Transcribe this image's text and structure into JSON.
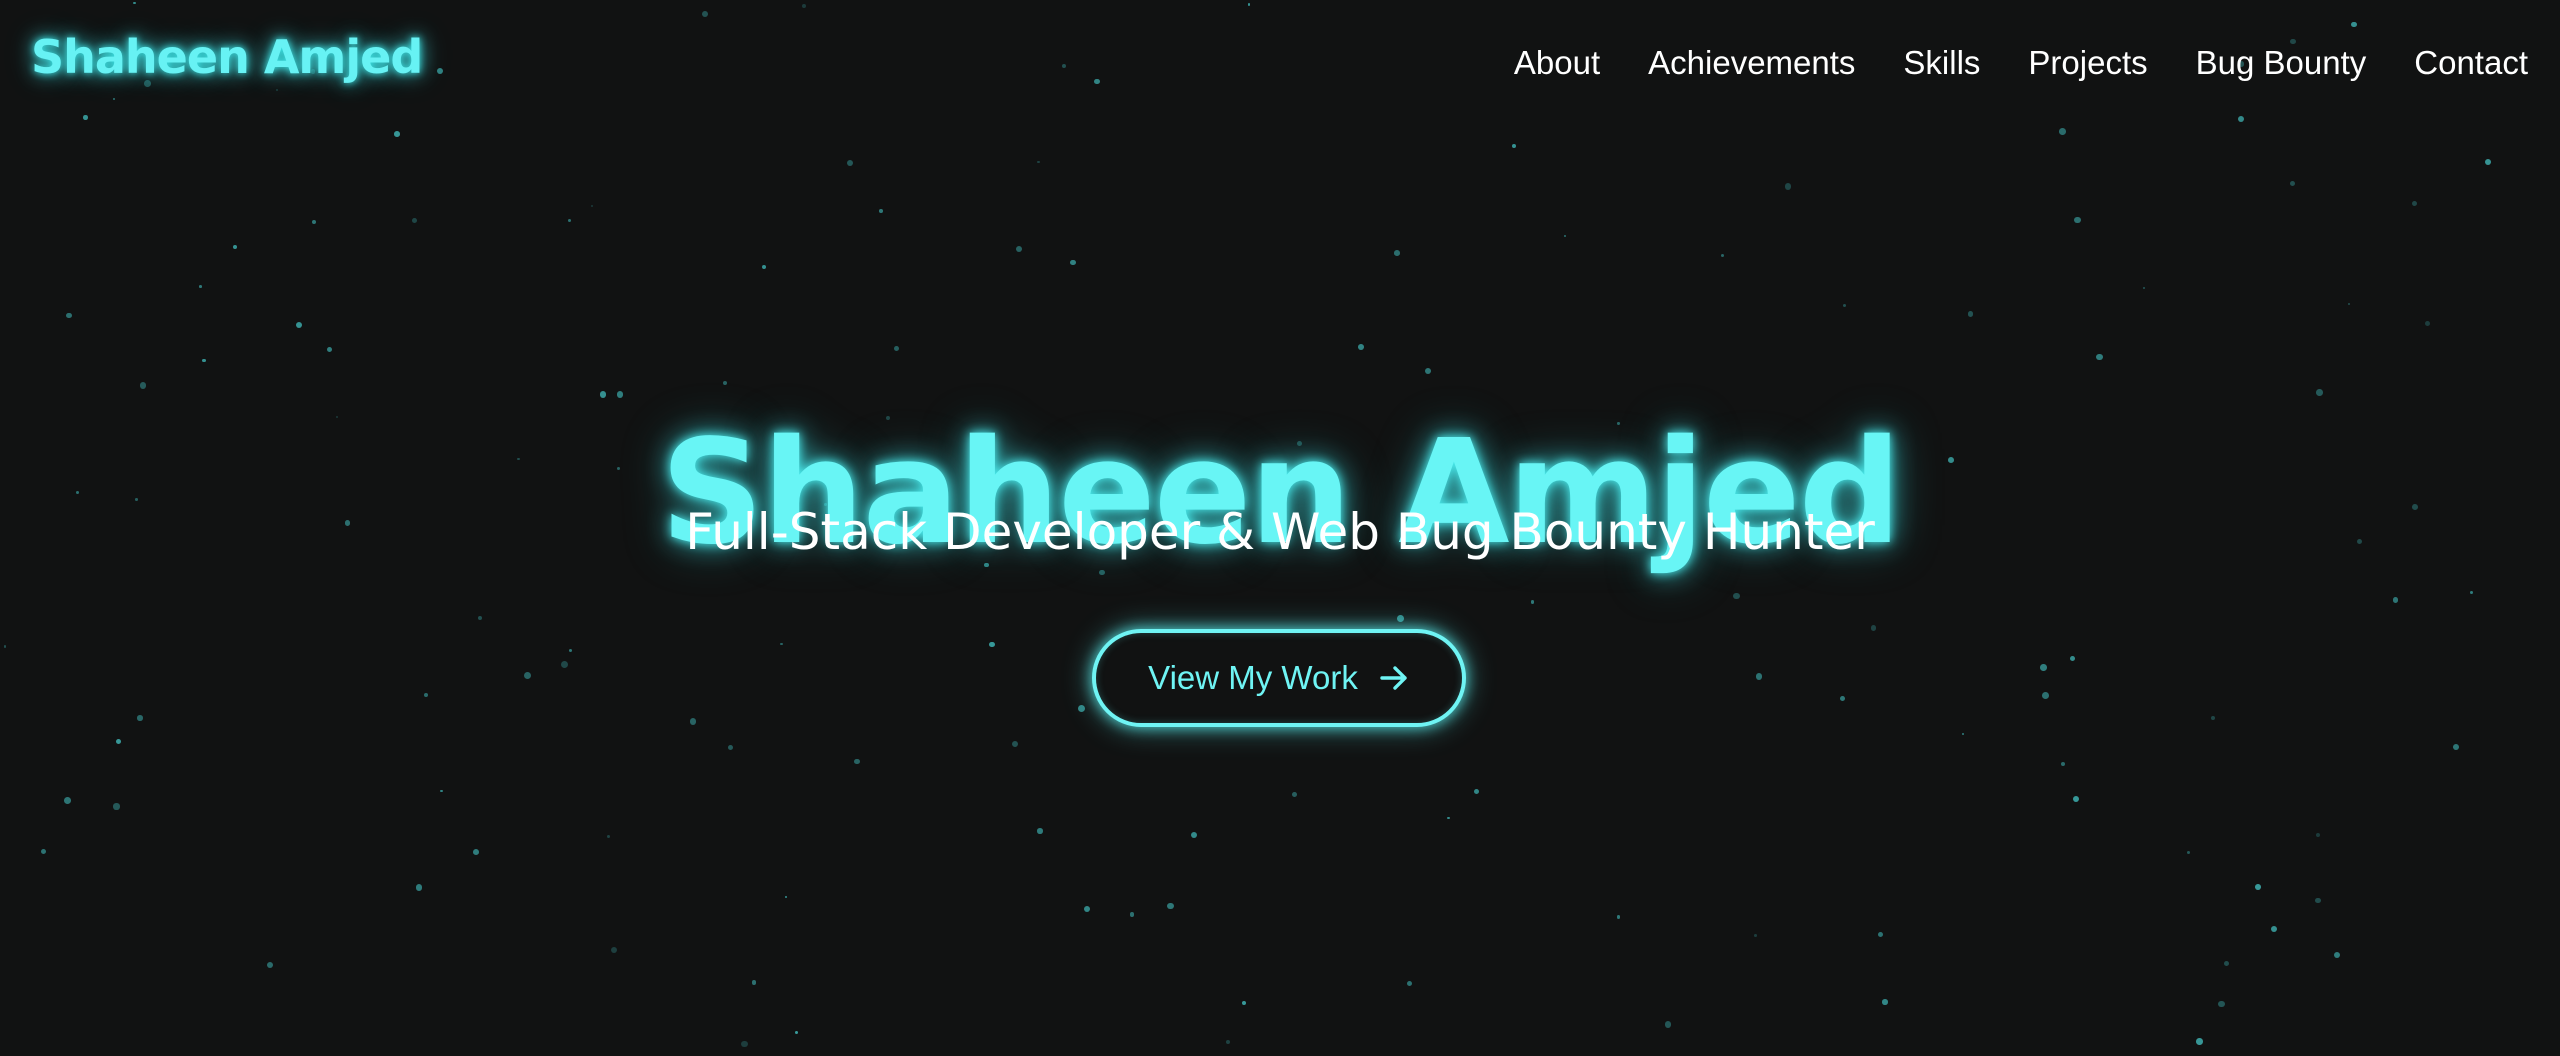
{
  "brand": {
    "logo_text": "Shaheen Amjed",
    "accent_color": "#67f2f4",
    "background_color": "#111212"
  },
  "nav": {
    "items": [
      {
        "label": "About"
      },
      {
        "label": "Achievements"
      },
      {
        "label": "Skills"
      },
      {
        "label": "Projects"
      },
      {
        "label": "Bug Bounty"
      },
      {
        "label": "Contact"
      }
    ]
  },
  "hero": {
    "title": "Shaheen Amjed",
    "subtitle": "Full-Stack Developer & Web Bug Bounty Hunter",
    "cta_label": "View My Work",
    "cta_icon": "arrow-right-icon"
  }
}
